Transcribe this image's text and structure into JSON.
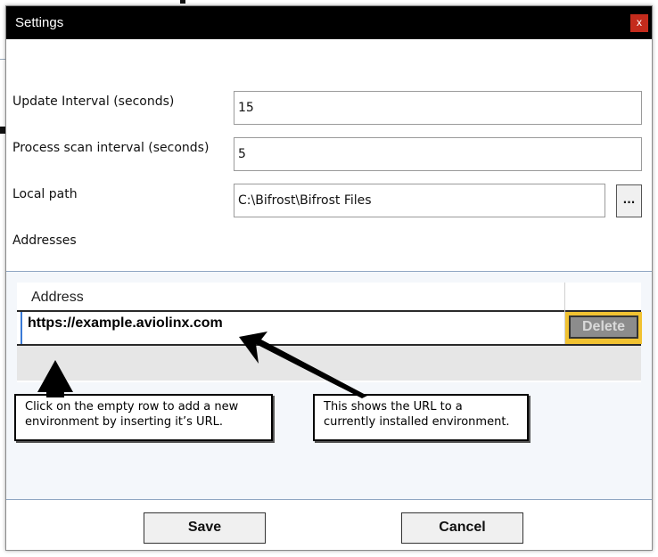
{
  "window": {
    "title": "Settings",
    "close_glyph": "x"
  },
  "settings": {
    "update_interval_label": "Update Interval (seconds)",
    "update_interval_value": "15",
    "process_scan_label": "Process scan interval (seconds)",
    "process_scan_value": "5",
    "local_path_label": "Local path",
    "local_path_value": "C:\\Bifrost\\Bifrost Files",
    "browse_label": "...",
    "addresses_label": "Addresses"
  },
  "addresses_grid": {
    "columns": [
      "Address"
    ],
    "rows": [
      {
        "address": "https://example.aviolinx.com",
        "delete_label": "Delete"
      }
    ]
  },
  "callouts": {
    "left": "Click on the empty row to add a new environment by inserting it’s URL.",
    "right": "This shows the URL to a currently installed environment."
  },
  "footer": {
    "save_label": "Save",
    "cancel_label": "Cancel"
  },
  "colors": {
    "titlebar": "#000000",
    "close_button": "#c42b1c",
    "delete_cell_highlight": "#f1c232",
    "delete_button": "#8c8c8c"
  },
  "icons": {
    "close": "close-icon",
    "browse": "ellipsis-icon"
  }
}
